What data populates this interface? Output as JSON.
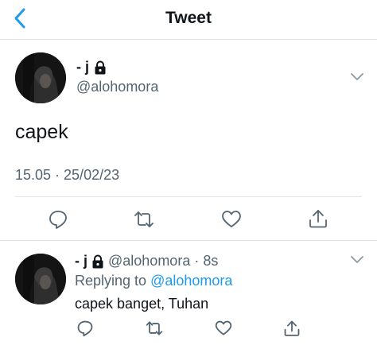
{
  "header": {
    "title": "Tweet",
    "back_icon": "chevron-left-icon"
  },
  "main_tweet": {
    "display_name": "- j",
    "protected_icon": "lock-icon",
    "handle": "@alohomora",
    "text": "capek",
    "timestamp": "15.05 · 25/02/23",
    "actions": [
      "reply-icon",
      "retweet-icon",
      "like-icon",
      "share-icon"
    ]
  },
  "reply": {
    "display_name": "- j",
    "protected_icon": "lock-icon",
    "handle": "@alohomora",
    "separator": "·",
    "time": "8s",
    "replying_prefix": "Replying to",
    "replying_handle": "@alohomora",
    "text": "capek banget, Tuhan",
    "actions": [
      "reply-icon",
      "retweet-icon",
      "like-icon",
      "share-icon"
    ]
  },
  "colors": {
    "accent": "#1d9bf0",
    "secondary_text": "#536471",
    "divider": "#e1e5e8"
  }
}
